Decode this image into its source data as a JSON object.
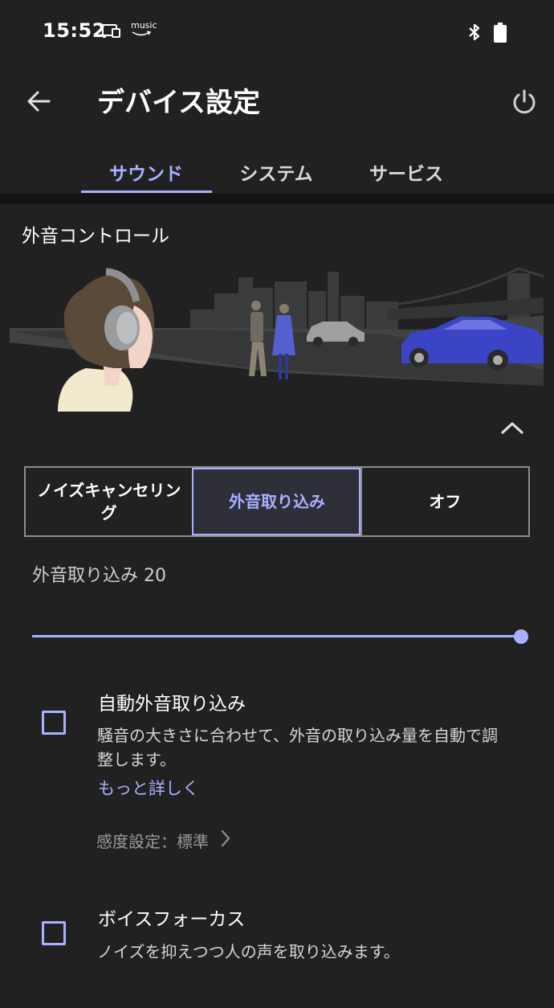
{
  "status_bar": {
    "time": "15:52",
    "music_label": "music",
    "icons": [
      "cast-icon",
      "amazon-music-icon",
      "bluetooth-icon",
      "battery-icon"
    ]
  },
  "app_bar": {
    "title": "デバイス設定",
    "back_icon": "arrow-left-icon",
    "power_icon": "power-icon"
  },
  "tabs": [
    {
      "label": "サウンド",
      "active": true
    },
    {
      "label": "システム",
      "active": false
    },
    {
      "label": "サービス",
      "active": false
    }
  ],
  "ambient_control": {
    "section_title": "外音コントロール",
    "collapse_icon": "chevron-up-icon",
    "modes": [
      {
        "label": "ノイズキャンセリング",
        "selected": false
      },
      {
        "label": "外音取り込み",
        "selected": true
      },
      {
        "label": "オフ",
        "selected": false
      }
    ],
    "slider_label": "外音取り込み 20",
    "slider_level": 20,
    "slider_max": 20
  },
  "options": {
    "auto_ambient": {
      "title": "自動外音取り込み",
      "description": "騒音の大きさに合わせて、外音の取り込み量を自動で調整します。",
      "more_link": "もっと詳しく",
      "sensitivity": "感度設定：標準",
      "checked": false
    },
    "voice_focus": {
      "title": "ボイスフォーカス",
      "description": "ノイズを抑えつつ人の声を取り込みます。",
      "checked": false
    }
  },
  "colors": {
    "background": "#212121",
    "accent": "#a9b0ff",
    "divider": "#141414"
  }
}
